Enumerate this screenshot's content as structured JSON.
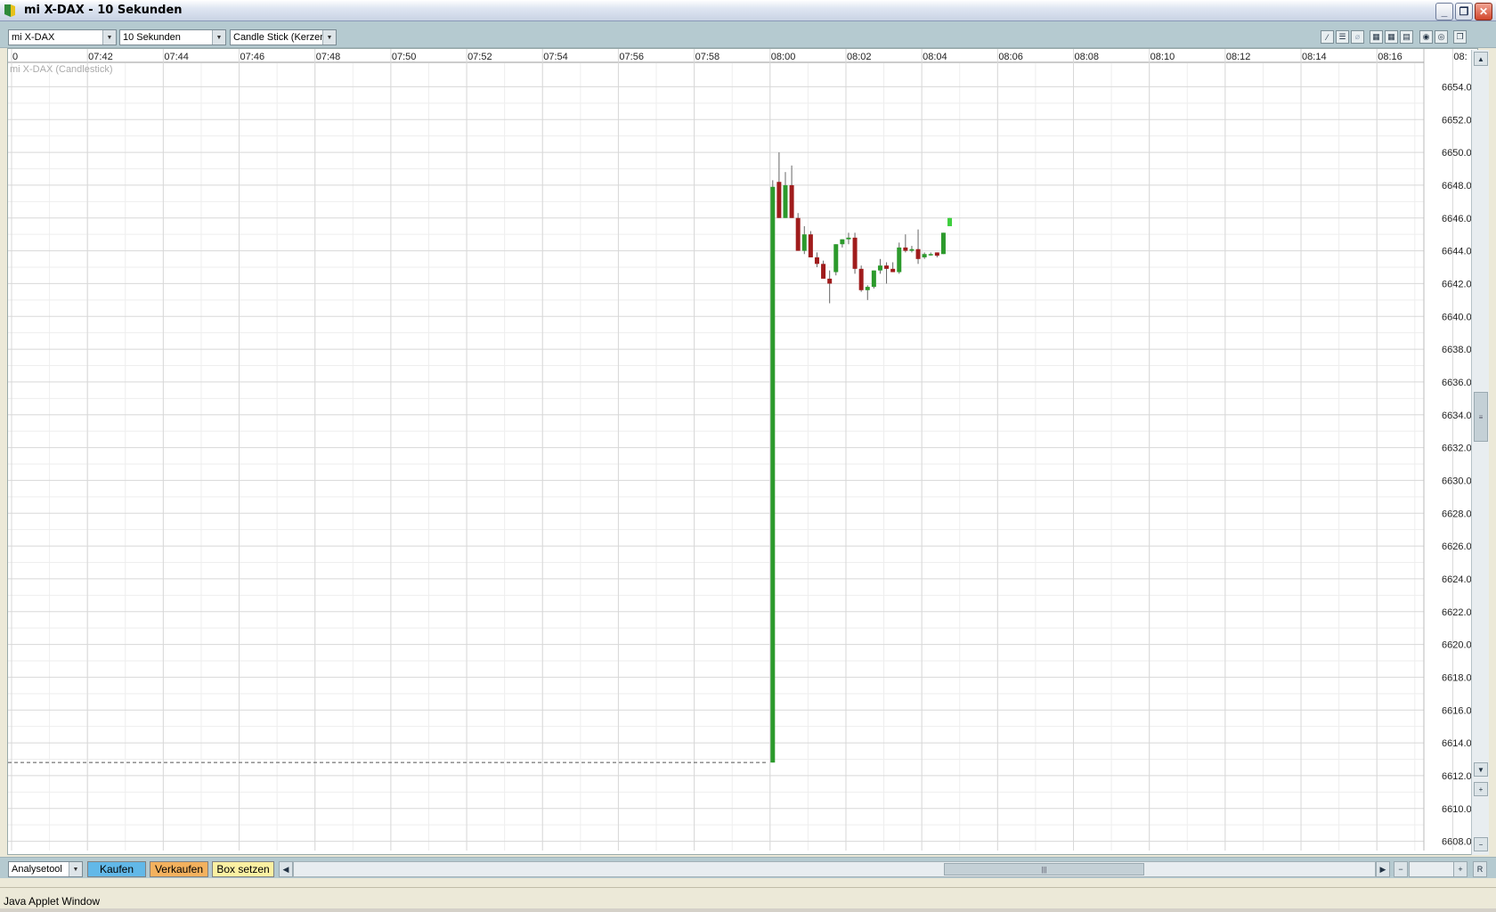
{
  "window": {
    "title": "mi X-DAX - 10 Sekunden",
    "status": "Java Applet Window"
  },
  "toolbar": {
    "instrument": "mi X-DAX",
    "interval": "10 Sekunden",
    "chart_type": "Candle Stick (Kerzen"
  },
  "bottom": {
    "analysetool": "Analysetool",
    "buy": "Kaufen",
    "sell": "Verkaufen",
    "box": "Box setzen",
    "reset": "R"
  },
  "colors": {
    "up": "#2c9a2c",
    "up_last": "#3fcf3f",
    "down": "#a01c1c",
    "grid": "#d8d8d8",
    "grid_minor": "#eeeeee"
  },
  "chart_data": {
    "type": "candlestick",
    "series_label": "mi X-DAX (Candlestick)",
    "x_ticks": [
      "0",
      "07:42",
      "07:44",
      "07:46",
      "07:48",
      "07:50",
      "07:52",
      "07:54",
      "07:56",
      "07:58",
      "08:00",
      "08:02",
      "08:04",
      "08:06",
      "08:08",
      "08:10",
      "08:12",
      "08:14",
      "08:16",
      "08:"
    ],
    "y_ticks": [
      "6654.0",
      "6652.0",
      "6650.0",
      "6648.0",
      "6646.0",
      "6644.0",
      "6642.0",
      "6640.0",
      "6638.0",
      "6636.0",
      "6634.0",
      "6632.0",
      "6630.0",
      "6628.0",
      "6626.0",
      "6624.0",
      "6622.0",
      "6620.0",
      "6618.0",
      "6616.0",
      "6614.0",
      "6612.0",
      "6610.0",
      "6608.0"
    ],
    "ylim": [
      6607.0,
      6655.0
    ],
    "xlim_seconds": [
      0,
      2240
    ],
    "reference_price": 6612.8,
    "candles": [
      {
        "t": 1200,
        "o": 6612.8,
        "h": 6648.3,
        "l": 6612.8,
        "c": 6647.9
      },
      {
        "t": 1210,
        "o": 6648.2,
        "h": 6650.0,
        "l": 6646.0,
        "c": 6646.0
      },
      {
        "t": 1220,
        "o": 6646.0,
        "h": 6648.8,
        "l": 6646.0,
        "c": 6648.0
      },
      {
        "t": 1230,
        "o": 6648.0,
        "h": 6649.2,
        "l": 6646.0,
        "c": 6646.0
      },
      {
        "t": 1240,
        "o": 6646.0,
        "h": 6646.3,
        "l": 6644.0,
        "c": 6644.0
      },
      {
        "t": 1250,
        "o": 6644.0,
        "h": 6645.5,
        "l": 6643.8,
        "c": 6645.0
      },
      {
        "t": 1260,
        "o": 6645.0,
        "h": 6645.2,
        "l": 6643.6,
        "c": 6643.6
      },
      {
        "t": 1270,
        "o": 6643.6,
        "h": 6643.9,
        "l": 6643.0,
        "c": 6643.2
      },
      {
        "t": 1280,
        "o": 6643.2,
        "h": 6643.4,
        "l": 6642.3,
        "c": 6642.3
      },
      {
        "t": 1290,
        "o": 6642.3,
        "h": 6642.8,
        "l": 6640.8,
        "c": 6642.0
      },
      {
        "t": 1300,
        "o": 6642.7,
        "h": 6644.4,
        "l": 6642.5,
        "c": 6644.4
      },
      {
        "t": 1310,
        "o": 6644.4,
        "h": 6644.7,
        "l": 6644.2,
        "c": 6644.7
      },
      {
        "t": 1320,
        "o": 6644.7,
        "h": 6645.1,
        "l": 6644.4,
        "c": 6644.8
      },
      {
        "t": 1330,
        "o": 6644.8,
        "h": 6645.1,
        "l": 6642.6,
        "c": 6642.9
      },
      {
        "t": 1340,
        "o": 6642.9,
        "h": 6643.1,
        "l": 6641.5,
        "c": 6641.6
      },
      {
        "t": 1350,
        "o": 6641.6,
        "h": 6641.9,
        "l": 6641.0,
        "c": 6641.8
      },
      {
        "t": 1360,
        "o": 6641.8,
        "h": 6642.8,
        "l": 6641.7,
        "c": 6642.8
      },
      {
        "t": 1370,
        "o": 6642.8,
        "h": 6643.5,
        "l": 6642.6,
        "c": 6643.1
      },
      {
        "t": 1380,
        "o": 6643.1,
        "h": 6643.3,
        "l": 6642.0,
        "c": 6642.9
      },
      {
        "t": 1390,
        "o": 6642.9,
        "h": 6643.3,
        "l": 6642.7,
        "c": 6642.7
      },
      {
        "t": 1400,
        "o": 6642.7,
        "h": 6644.5,
        "l": 6642.6,
        "c": 6644.2
      },
      {
        "t": 1410,
        "o": 6644.2,
        "h": 6645.0,
        "l": 6643.9,
        "c": 6644.0
      },
      {
        "t": 1420,
        "o": 6644.0,
        "h": 6644.3,
        "l": 6643.9,
        "c": 6644.1
      },
      {
        "t": 1430,
        "o": 6644.1,
        "h": 6645.3,
        "l": 6643.2,
        "c": 6643.5
      },
      {
        "t": 1440,
        "o": 6643.6,
        "h": 6643.9,
        "l": 6643.5,
        "c": 6643.8
      },
      {
        "t": 1450,
        "o": 6643.8,
        "h": 6643.9,
        "l": 6643.7,
        "c": 6643.8
      },
      {
        "t": 1460,
        "o": 6643.9,
        "h": 6643.9,
        "l": 6643.6,
        "c": 6643.7
      },
      {
        "t": 1470,
        "o": 6643.8,
        "h": 6645.1,
        "l": 6643.8,
        "c": 6645.1
      },
      {
        "t": 1480,
        "o": 6645.5,
        "h": 6646.0,
        "l": 6645.5,
        "c": 6646.0
      }
    ]
  }
}
